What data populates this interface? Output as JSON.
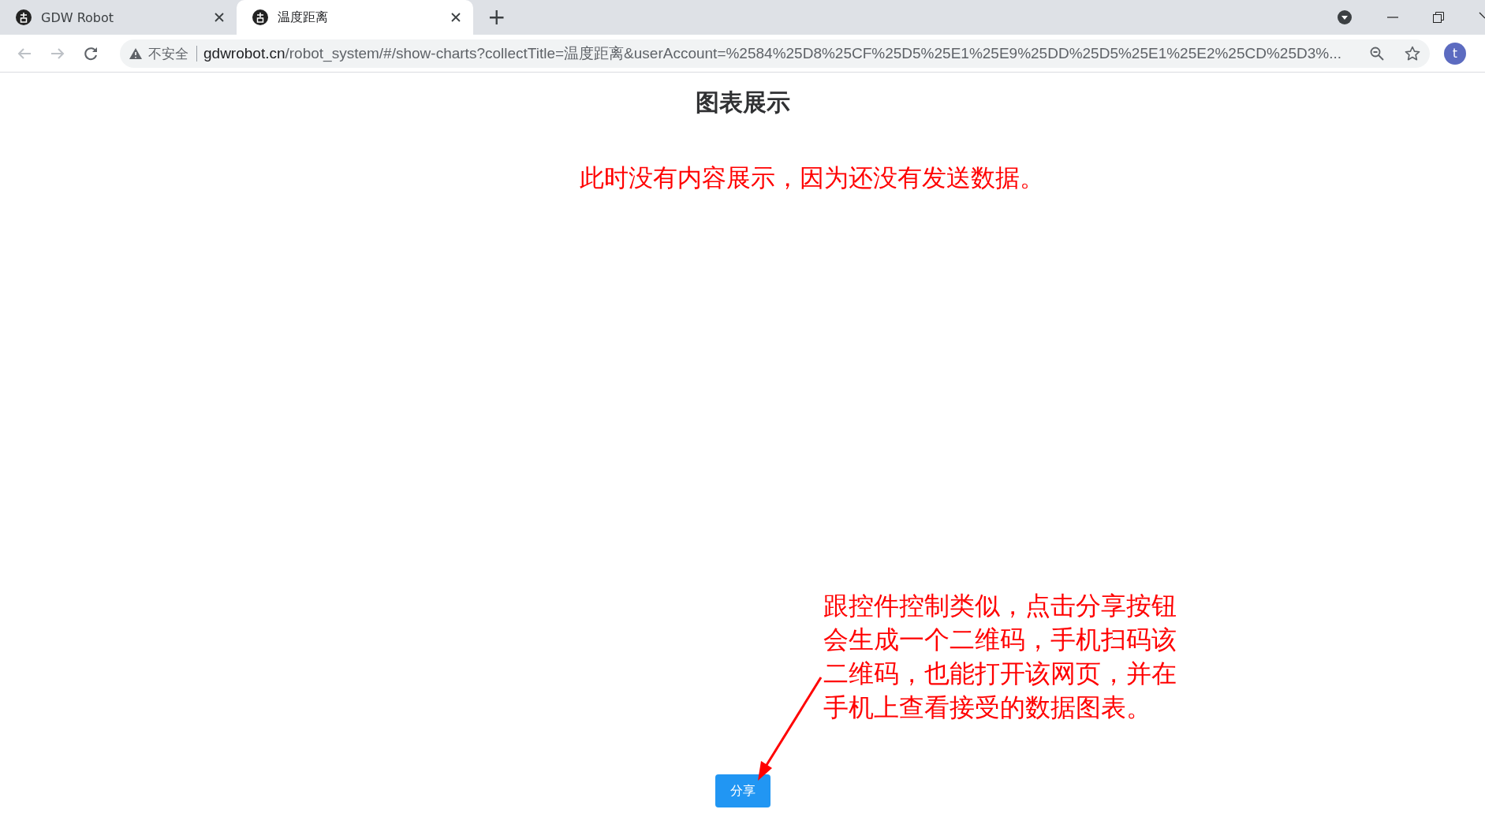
{
  "browser": {
    "tabs": [
      {
        "title": "GDW Robot",
        "selected": false
      },
      {
        "title": "温度距离",
        "selected": true
      }
    ],
    "new_tab": "+",
    "security_label": "不安全",
    "url": {
      "host": "gdwrobot.cn",
      "path": "/robot_system/#/show-charts?collectTitle=温度距离&userAccount=%2584%25D8%25CF%25D5%25E1%25E9%25DD%25D5%25E1%25E2%25CD%25D3%..."
    },
    "profile_initial": "t"
  },
  "page": {
    "title": "图表展示",
    "share_button": "分享"
  },
  "annotations": [
    {
      "kind": "note",
      "text": "此时没有内容展示，因为还没有发送数据。"
    },
    {
      "kind": "arrow-note",
      "text": "跟控件控制类似，点击分享按钮会生成一个二维码，手机扫码该二维码，也能打开该网页，并在手机上查看接受的数据图表。"
    }
  ]
}
